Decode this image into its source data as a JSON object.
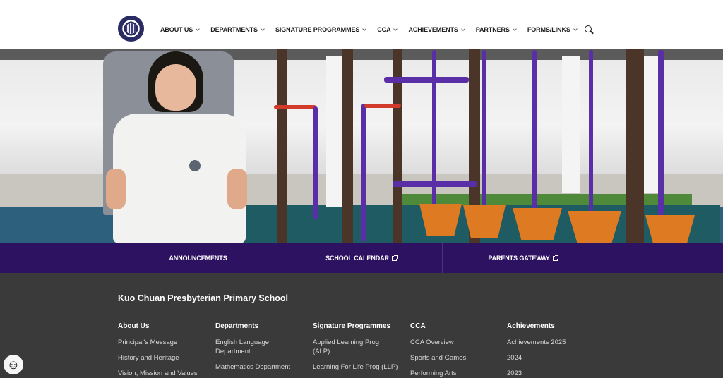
{
  "header": {
    "logo_icon": "school-crest-icon",
    "nav": [
      {
        "label": "ABOUT US"
      },
      {
        "label": "DEPARTMENTS"
      },
      {
        "label": "SIGNATURE PROGRAMMES"
      },
      {
        "label": "CCA"
      },
      {
        "label": "ACHIEVEMENTS"
      },
      {
        "label": "PARTNERS"
      },
      {
        "label": "FORMS/LINKS"
      }
    ],
    "search_icon": "search-icon"
  },
  "quick_links": [
    {
      "label": "ANNOUNCEMENTS",
      "external": false
    },
    {
      "label": "SCHOOL CALENDAR",
      "external": true
    },
    {
      "label": "PARENTS GATEWAY",
      "external": true
    }
  ],
  "footer": {
    "school_name": "Kuo Chuan Presbyterian Primary School",
    "columns": [
      {
        "heading": "About Us",
        "items": [
          "Principal's Message",
          "History and Heritage",
          "Vision, Mission and Values"
        ]
      },
      {
        "heading": "Departments",
        "items": [
          "English Language Department",
          "Mathematics Department"
        ]
      },
      {
        "heading": "Signature Programmes",
        "items": [
          "Applied Learning Prog (ALP)",
          "Learning For Life Prog (LLP)"
        ]
      },
      {
        "heading": "CCA",
        "items": [
          "CCA Overview",
          "Sports and Games",
          "Performing Arts"
        ]
      },
      {
        "heading": "Achievements",
        "items": [
          "Achievements 2025",
          "2024",
          "2023"
        ]
      }
    ]
  },
  "colors": {
    "brand_purple": "#2d1261",
    "footer_bg": "#3a3a3a"
  },
  "chat_icon": "smiley-face-icon"
}
